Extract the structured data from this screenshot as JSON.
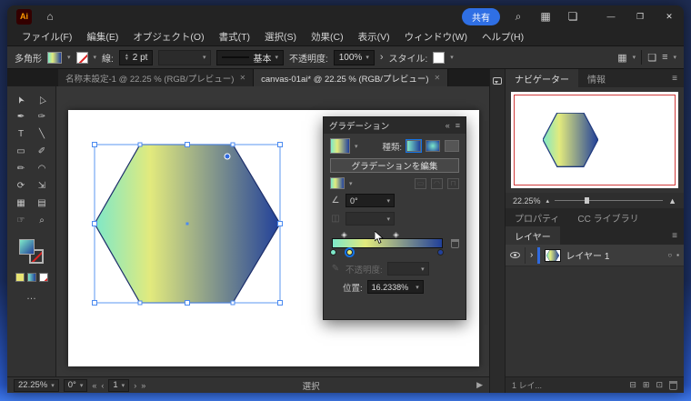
{
  "titlebar": {
    "app_badge": "Ai",
    "share_label": "共有",
    "window_minimize": "—",
    "window_maximize": "❐",
    "window_close": "✕"
  },
  "menubar": {
    "items": [
      {
        "label": "ファイル(F)"
      },
      {
        "label": "編集(E)"
      },
      {
        "label": "オブジェクト(O)"
      },
      {
        "label": "書式(T)"
      },
      {
        "label": "選択(S)"
      },
      {
        "label": "効果(C)"
      },
      {
        "label": "表示(V)"
      },
      {
        "label": "ウィンドウ(W)"
      },
      {
        "label": "ヘルプ(H)"
      }
    ]
  },
  "control_bar": {
    "context_label": "多角形",
    "stroke_label": "線:",
    "stroke_weight": "2 pt",
    "brush_definition": "基本",
    "opacity_label": "不透明度:",
    "opacity_value": "100%",
    "style_label": "スタイル:"
  },
  "document_tabs": [
    {
      "title": "名称未設定-1 @ 22.25 % (RGB/プレビュー)",
      "close_glyph": "✕"
    },
    {
      "title": "canvas-01ai* @ 22.25 % (RGB/プレビュー)",
      "close_glyph": "✕"
    }
  ],
  "toolbar": {
    "tools": [
      {
        "name": "selection-tool",
        "glyph": "➤"
      },
      {
        "name": "direct-selection-tool",
        "glyph": "▷"
      },
      {
        "name": "pen-tool",
        "glyph": "✒"
      },
      {
        "name": "curvature-tool",
        "glyph": "✑"
      },
      {
        "name": "type-tool",
        "glyph": "T"
      },
      {
        "name": "line-segment-tool",
        "glyph": "╲"
      },
      {
        "name": "rectangle-tool",
        "glyph": "▭"
      },
      {
        "name": "paintbrush-tool",
        "glyph": "✐"
      },
      {
        "name": "pencil-tool",
        "glyph": "✏"
      },
      {
        "name": "shaper-tool",
        "glyph": "◠"
      },
      {
        "name": "rotate-tool",
        "glyph": "⟳"
      },
      {
        "name": "scale-tool",
        "glyph": "⇲"
      },
      {
        "name": "mesh-tool",
        "glyph": "▦"
      },
      {
        "name": "gradient-tool",
        "glyph": "▤"
      },
      {
        "name": "hand-tool",
        "glyph": "☞"
      },
      {
        "name": "zoom-tool",
        "glyph": "⌕"
      }
    ],
    "more_glyph": "…"
  },
  "gradient_panel": {
    "title": "グラデーション",
    "type_label": "種類:",
    "edit_button": "グラデーションを編集",
    "angle_value": "0°",
    "opacity_label": "不透明度:",
    "position_label": "位置:",
    "position_value": "16.2338%"
  },
  "navigator": {
    "tab_navigator": "ナビゲーター",
    "tab_info": "情報",
    "zoom": "22.25%"
  },
  "right_tabs": {
    "properties": "プロパティ",
    "libraries": "CC ライブラリ"
  },
  "layers_panel": {
    "title": "レイヤー",
    "layer_name": "レイヤー 1",
    "count_label": "1 レイ..."
  },
  "status_bar": {
    "zoom": "22.25%",
    "angle": "0°",
    "artboard": "1",
    "tool_name": "選択"
  },
  "icons": {
    "home": "⌂",
    "search": "⌕",
    "workspace": "▦",
    "arrange": "❏",
    "panel_menu": "≡",
    "collapse": "«",
    "caret_down": "▾",
    "chevron_right": "›",
    "chevron_right2": "▶",
    "angle_icon": "∠",
    "aspect_icon": "◫",
    "nav_first": "«",
    "nav_prev": "‹",
    "nav_next": "›",
    "nav_last": "»",
    "zoom_out_tri": "▴",
    "zoom_in_tri": "▲",
    "mask": "⊟",
    "sublayer": "⊞",
    "new_layer": "⊡",
    "opacity_pen": "✎"
  },
  "colors": {
    "accent": "#1473e6",
    "selection_blue": "#5b97f2",
    "artboard_outline_red": "#d03a3a",
    "gradient_stops": [
      "#7de8c9",
      "#e2ea7d",
      "#21409a"
    ]
  }
}
